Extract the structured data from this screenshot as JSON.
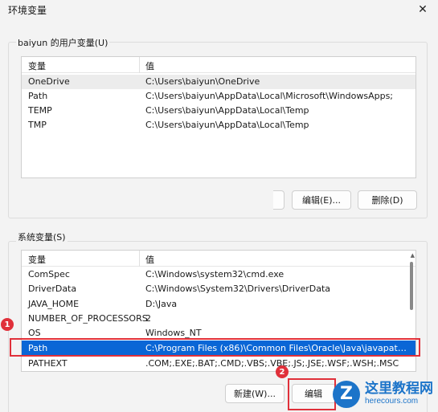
{
  "window": {
    "title": "环境变量"
  },
  "user_section": {
    "label": "baiyun 的用户变量(U)",
    "columns": [
      "变量",
      "值"
    ],
    "rows": [
      {
        "name": "OneDrive",
        "value": "C:\\Users\\baiyun\\OneDrive"
      },
      {
        "name": "Path",
        "value": "C:\\Users\\baiyun\\AppData\\Local\\Microsoft\\WindowsApps;"
      },
      {
        "name": "TEMP",
        "value": "C:\\Users\\baiyun\\AppData\\Local\\Temp"
      },
      {
        "name": "TMP",
        "value": "C:\\Users\\baiyun\\AppData\\Local\\Temp"
      }
    ],
    "buttons": {
      "edit": "编辑(E)...",
      "delete": "删除(D)"
    }
  },
  "system_section": {
    "label": "系统变量(S)",
    "columns": [
      "变量",
      "值"
    ],
    "rows": [
      {
        "name": "ComSpec",
        "value": "C:\\Windows\\system32\\cmd.exe"
      },
      {
        "name": "DriverData",
        "value": "C:\\Windows\\System32\\Drivers\\DriverData"
      },
      {
        "name": "JAVA_HOME",
        "value": "D:\\Java"
      },
      {
        "name": "NUMBER_OF_PROCESSORS",
        "value": "2"
      },
      {
        "name": "OS",
        "value": "Windows_NT"
      },
      {
        "name": "Path",
        "value": "C:\\Program Files (x86)\\Common Files\\Oracle\\Java\\javapath;C:..."
      },
      {
        "name": "PATHEXT",
        "value": ".COM;.EXE;.BAT;.CMD;.VBS;.VBE;.JS;.JSE;.WSF;.WSH;.MSC"
      }
    ],
    "buttons": {
      "new": "新建(W)...",
      "edit": "编辑"
    }
  },
  "annotations": {
    "badge1": "1",
    "badge2": "2"
  },
  "watermark": {
    "logo_letter": "Z",
    "name": "这里教程网",
    "url": "herecours.com"
  },
  "colors": {
    "selected": "#0a66d6",
    "highlight": "#e0303a",
    "brand": "#1c74c9"
  }
}
